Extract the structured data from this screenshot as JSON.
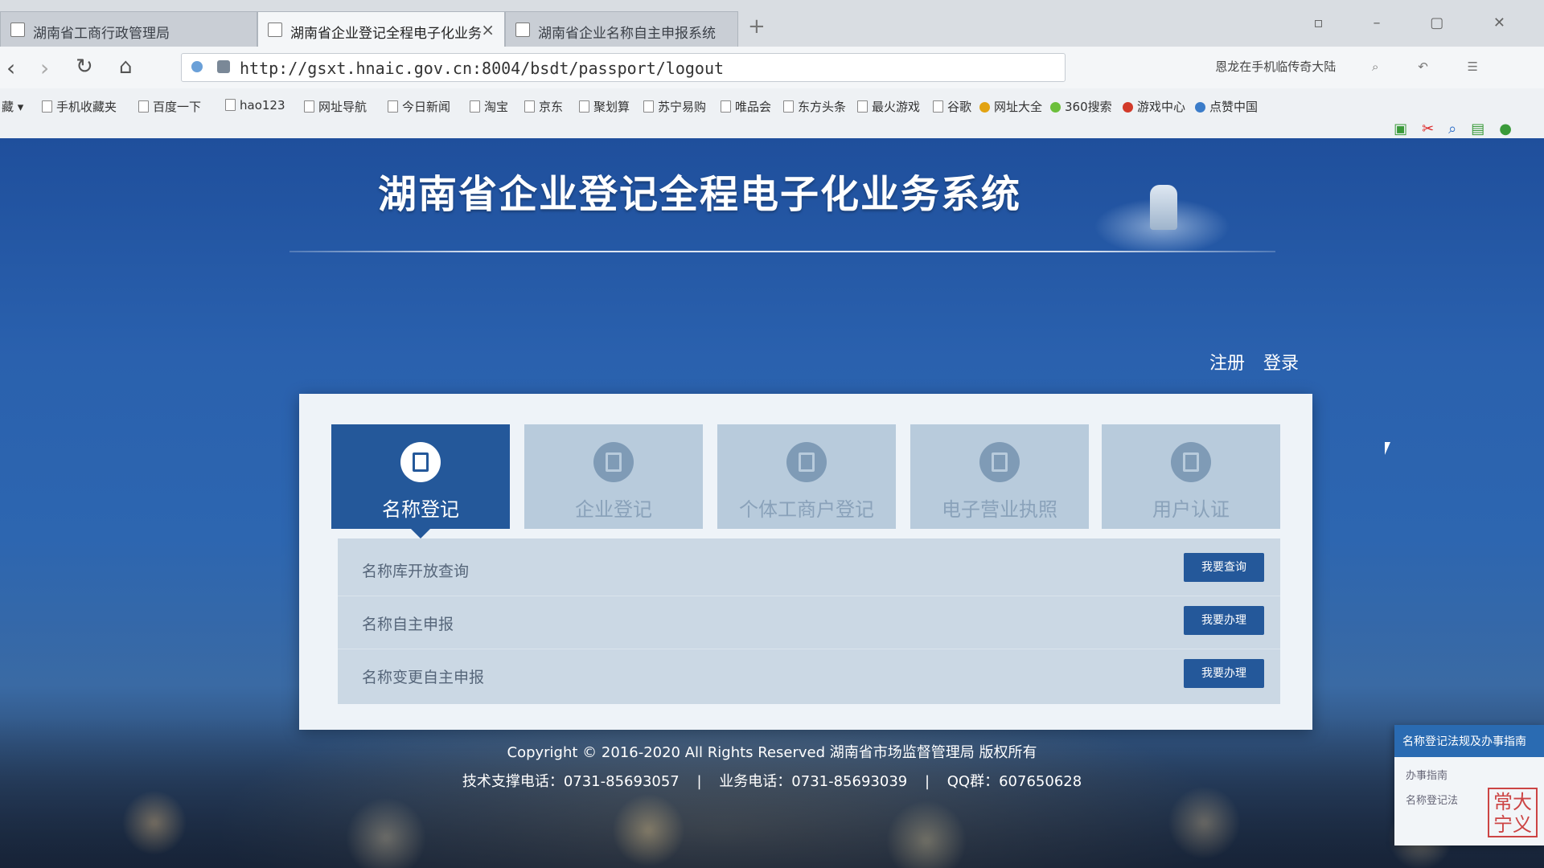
{
  "browser": {
    "tabs": [
      {
        "title": "湖南省工商行政管理局",
        "active": false
      },
      {
        "title": "湖南省企业登记全程电子化业务",
        "active": true
      },
      {
        "title": "湖南省企业名称自主申报系统",
        "active": false
      }
    ],
    "address": "http://gsxt.hnaic.gov.cn:8004/bsdt/passport/logout",
    "search_hint": "恩龙在手机临传奇大陆",
    "bookmarks_label": "藏",
    "bookmarks": [
      "手机收藏夹",
      "百度一下",
      "hao123",
      "网址导航",
      "今日新闻",
      "淘宝",
      "京东",
      "聚划算",
      "苏宁易购",
      "唯品会",
      "东方头条",
      "最火游戏",
      "谷歌",
      "网址大全",
      "360搜索",
      "游戏中心",
      "点赞中国"
    ]
  },
  "page": {
    "title": "湖南省企业登记全程电子化业务系统",
    "auth": {
      "register": "注册",
      "login": "登录"
    },
    "service_tabs": [
      {
        "label": "名称登记",
        "icon": "document-icon",
        "active": true
      },
      {
        "label": "企业登记",
        "icon": "company-icon",
        "active": false
      },
      {
        "label": "个体工商户登记",
        "icon": "business-icon",
        "active": false
      },
      {
        "label": "电子营业执照",
        "icon": "license-icon",
        "active": false
      },
      {
        "label": "用户认证",
        "icon": "user-icon",
        "active": false
      }
    ],
    "service_rows": [
      {
        "label": "名称库开放查询",
        "button": "我要查询"
      },
      {
        "label": "名称自主申报",
        "button": "我要办理"
      },
      {
        "label": "名称变更自主申报",
        "button": "我要办理"
      }
    ],
    "footer": {
      "copyright": "Copyright © 2016-2020 All Rights Reserved 湖南省市场监督管理局 版权所有",
      "tech_phone": "技术支撑电话：0731-85693057",
      "biz_phone": "业务电话：0731-85693039",
      "qq": "QQ群：607650628"
    },
    "side_widget": {
      "header": "名称登记法规及办事指南",
      "items": [
        "办事指南",
        "名称登记法"
      ]
    }
  },
  "colors": {
    "primary": "#24589a",
    "tab_inactive": "#b8cbdc",
    "background": "#2a61ae"
  }
}
